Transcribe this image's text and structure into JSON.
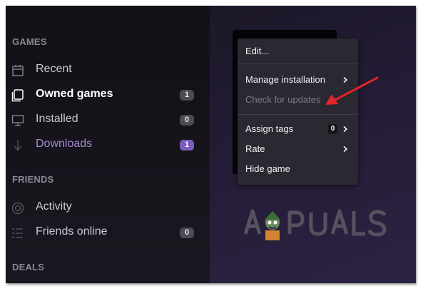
{
  "sidebar": {
    "sections": [
      {
        "title": "GAMES"
      },
      {
        "title": "FRIENDS"
      },
      {
        "title": "DEALS"
      }
    ],
    "games": [
      {
        "label": "Recent",
        "icon": "calendar-icon"
      },
      {
        "label": "Owned games",
        "icon": "library-icon",
        "count": "1"
      },
      {
        "label": "Installed",
        "icon": "monitor-icon",
        "count": "0"
      },
      {
        "label": "Downloads",
        "icon": "download-icon",
        "count": "1"
      }
    ],
    "friends": [
      {
        "label": "Activity",
        "icon": "activity-icon"
      },
      {
        "label": "Friends online",
        "icon": "friends-list-icon",
        "count": "0"
      }
    ]
  },
  "context_menu": {
    "edit": "Edit...",
    "manage_installation": "Manage installation",
    "check_for_updates": "Check for updates",
    "assign_tags": "Assign tags",
    "assign_tags_count": "0",
    "rate": "Rate",
    "hide_game": "Hide game"
  },
  "watermark": {
    "text": "APPUALS"
  },
  "colors": {
    "accent": "#a58ad6",
    "annotation_arrow": "#e0242a",
    "menu_bg": "#2a2830",
    "sidebar_bg": "#141218"
  }
}
